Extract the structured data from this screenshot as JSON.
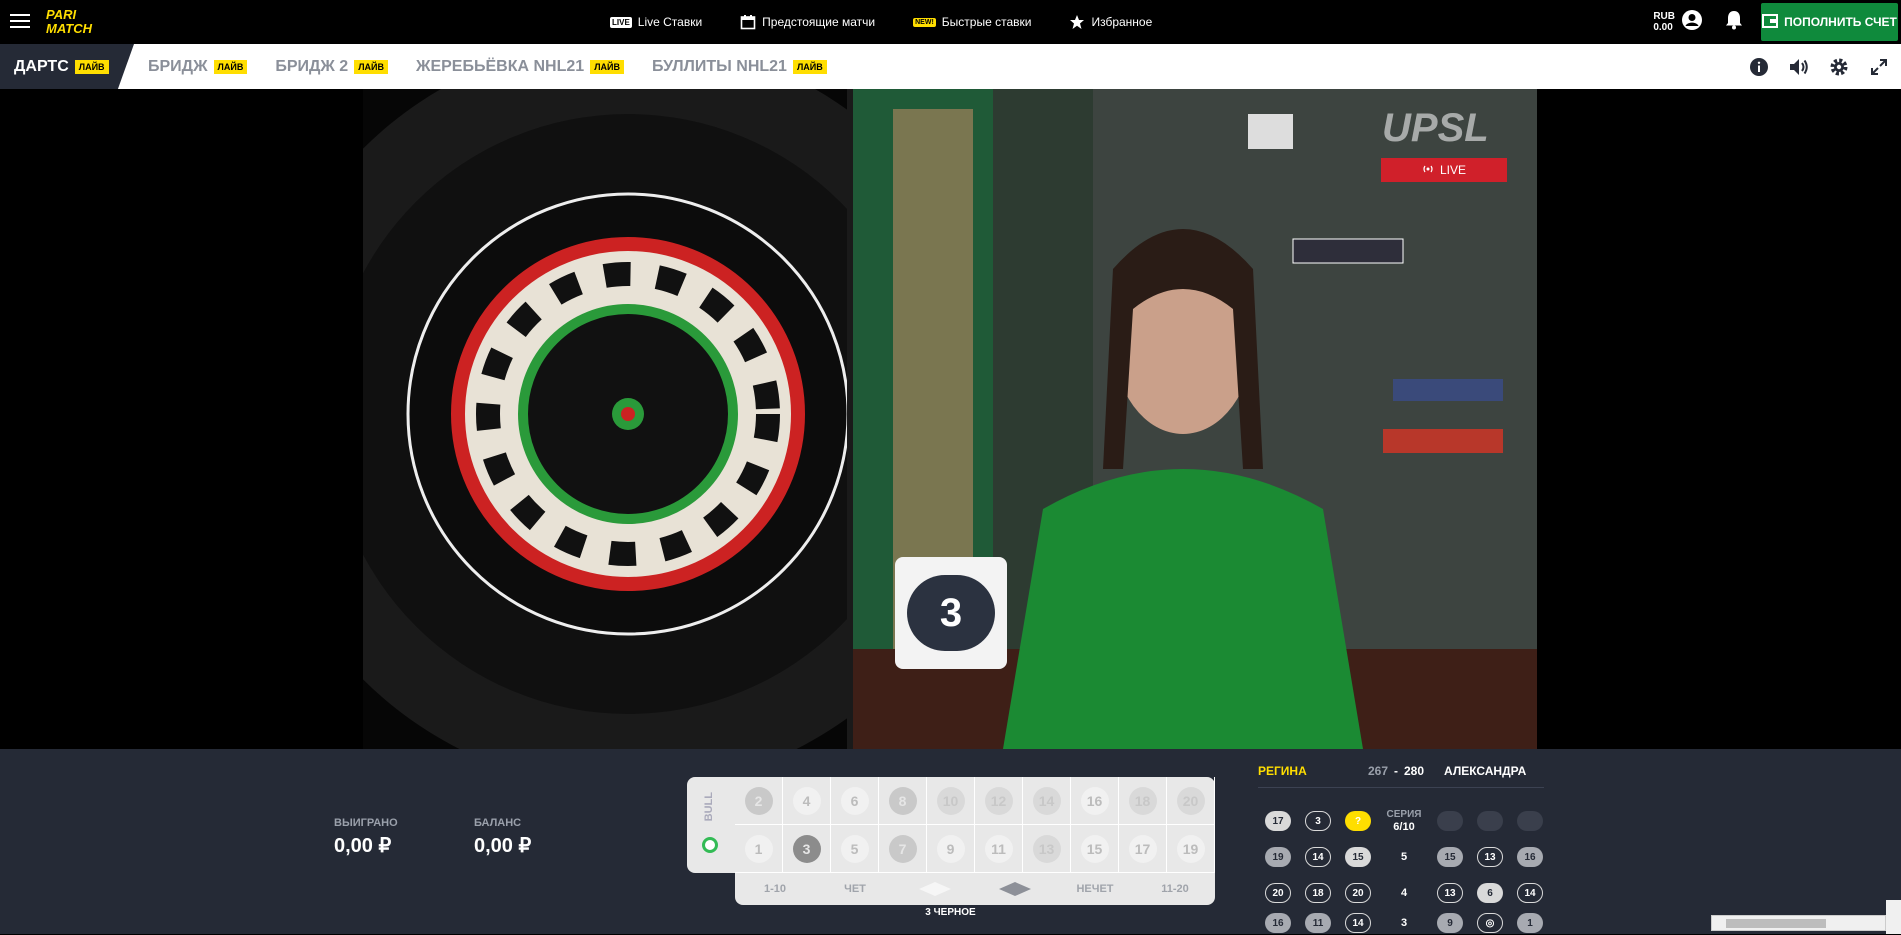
{
  "brand": {
    "line1": "PARI",
    "line2": "MATCH",
    "color": "#ffde00"
  },
  "nav": [
    {
      "label": "Live Ставки",
      "icon": "live-badge-icon",
      "badge": "LIVE"
    },
    {
      "label": "Предстоящие матчи",
      "icon": "calendar-icon"
    },
    {
      "label": "Быстрые ставки",
      "icon": "new-badge-icon",
      "badge": "NEW!"
    },
    {
      "label": "Избранное",
      "icon": "star-icon"
    }
  ],
  "account": {
    "currency": "RUB",
    "amount": "0.00",
    "deposit_label": "ПОПОЛНИТЬ СЧЕТ"
  },
  "tabs": [
    {
      "label": "Дартс",
      "badge": "ЛАЙВ"
    },
    {
      "label": "Бридж",
      "badge": "ЛАЙВ"
    },
    {
      "label": "Бридж 2",
      "badge": "ЛАЙВ"
    },
    {
      "label": "Жеребьёвка NHL21",
      "badge": "ЛАЙВ"
    },
    {
      "label": "Буллиты NHL21",
      "badge": "ЛАЙВ"
    }
  ],
  "video": {
    "live_label": "LIVE",
    "overlay_brand": "UPSL",
    "current_number": "3"
  },
  "stats": {
    "won_label": "ВЫИГРАНО",
    "won_value": "0,00 ₽",
    "balance_label": "БАЛАНС",
    "balance_value": "0,00 ₽"
  },
  "board": {
    "bull_label": "BULL",
    "even_row": [
      "2",
      "4",
      "6",
      "8",
      "10",
      "12",
      "14",
      "16",
      "18",
      "20"
    ],
    "odd_row": [
      "1",
      "3",
      "5",
      "7",
      "9",
      "11",
      "13",
      "15",
      "17",
      "19"
    ],
    "bets": [
      "1-10",
      "ЧЕТ",
      "",
      "",
      "НЕЧЕТ",
      "11-20"
    ],
    "result_label": "3 ЧЕРНОЕ"
  },
  "score": {
    "player_a": "РЕГИНА",
    "score_a": "267",
    "score_b": "280",
    "player_b": "АЛЕКСАНДРА",
    "series_label": "СЕРИЯ",
    "series_value": "6/10",
    "left_rows": [
      [
        "17",
        "3",
        "?"
      ],
      [
        "19",
        "14",
        "15"
      ],
      [
        "20",
        "18",
        "20"
      ],
      [
        "16",
        "11",
        "14"
      ]
    ],
    "mid_rows": [
      "5",
      "4",
      "3"
    ],
    "right_rows": [
      [
        "15",
        "13",
        "16"
      ],
      [
        "13",
        "6",
        "14"
      ],
      [
        "9",
        "◎",
        "1"
      ]
    ]
  }
}
